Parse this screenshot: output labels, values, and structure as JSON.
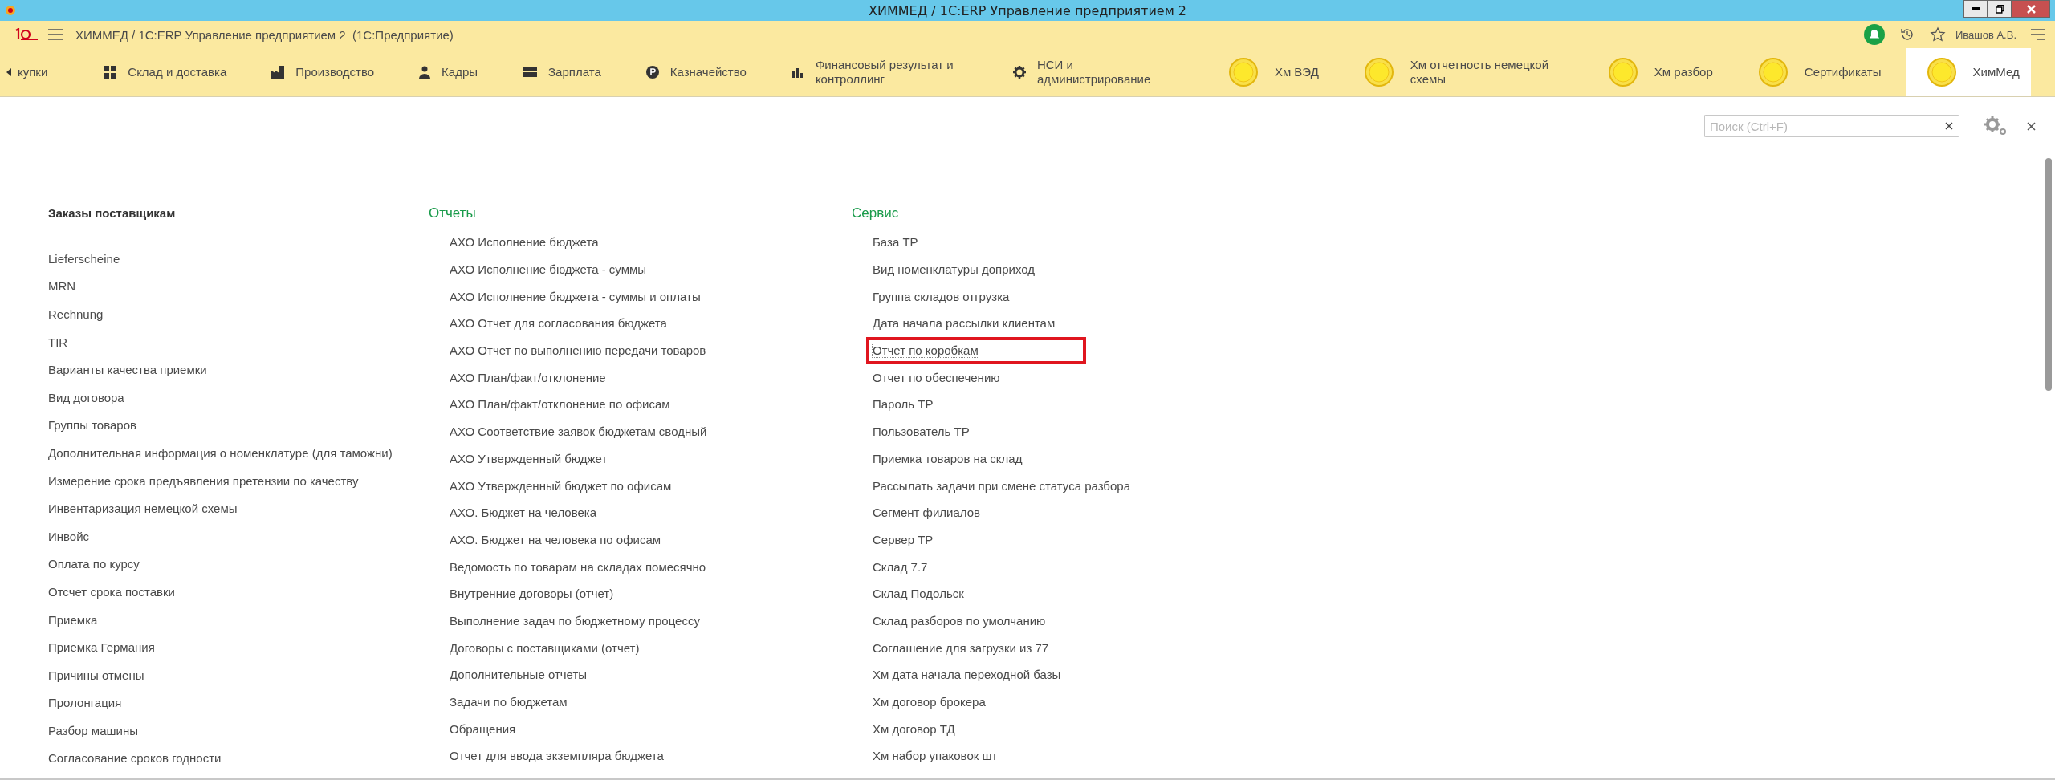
{
  "window": {
    "title": "ХИММЕД / 1С:ERP Управление предприятием 2"
  },
  "app_bar": {
    "title": "ХИММЕД / 1С:ERP Управление предприятием 2  (1С:Предприятие)",
    "user": "Ивашов А.В."
  },
  "sections": [
    {
      "label": "купки",
      "kind": "plain",
      "selected": false
    },
    {
      "label": "Склад и доставка",
      "kind": "grid",
      "selected": false
    },
    {
      "label": "Производство",
      "kind": "factory",
      "selected": false
    },
    {
      "label": "Кадры",
      "kind": "person",
      "selected": false
    },
    {
      "label": "Зарплата",
      "kind": "cash",
      "selected": false
    },
    {
      "label": "Казначейство",
      "kind": "coin",
      "selected": false
    },
    {
      "label": "Финансовый результат и контроллинг",
      "kind": "chart",
      "selected": false
    },
    {
      "label": "НСИ и администрирование",
      "kind": "gear",
      "selected": false
    },
    {
      "label": "Хм ВЭД",
      "kind": "custom",
      "selected": false
    },
    {
      "label": "Хм отчетность немецкой схемы",
      "kind": "custom",
      "selected": false
    },
    {
      "label": "Хм разбор",
      "kind": "custom",
      "selected": false
    },
    {
      "label": "Сертификаты",
      "kind": "custom",
      "selected": false
    },
    {
      "label": "ХимМед",
      "kind": "custom",
      "selected": true
    }
  ],
  "search": {
    "placeholder": "Поиск (Ctrl+F)"
  },
  "columns": [
    {
      "title": "Заказы поставщикам",
      "kind": "group",
      "items": [
        {
          "label": "Lieferscheine",
          "highlighted": false
        },
        {
          "label": "MRN",
          "highlighted": false
        },
        {
          "label": "Rechnung",
          "highlighted": false
        },
        {
          "label": "TIR",
          "highlighted": false
        },
        {
          "label": "Варианты качества приемки",
          "highlighted": false
        },
        {
          "label": "Вид договора",
          "highlighted": false
        },
        {
          "label": "Группы товаров",
          "highlighted": false
        },
        {
          "label": "Дополнительная информация о номенклатуре (для таможни)",
          "highlighted": false
        },
        {
          "label": "Измерение срока предъявления претензии по качеству",
          "highlighted": false
        },
        {
          "label": "Инвентаризация немецкой схемы",
          "highlighted": false
        },
        {
          "label": "Инвойс",
          "highlighted": false
        },
        {
          "label": "Оплата по курсу",
          "highlighted": false
        },
        {
          "label": "Отсчет срока поставки",
          "highlighted": false
        },
        {
          "label": "Приемка",
          "highlighted": false
        },
        {
          "label": "Приемка Германия",
          "highlighted": false
        },
        {
          "label": "Причины отмены",
          "highlighted": false
        },
        {
          "label": "Пролонгация",
          "highlighted": false
        },
        {
          "label": "Разбор машины",
          "highlighted": false
        },
        {
          "label": "Согласование сроков годности",
          "highlighted": false
        }
      ]
    },
    {
      "title": "Отчеты",
      "kind": "section",
      "items": [
        {
          "label": "АХО Исполнение бюджета",
          "highlighted": false
        },
        {
          "label": "АХО Исполнение бюджета - суммы",
          "highlighted": false
        },
        {
          "label": "АХО Исполнение бюджета - суммы и оплаты",
          "highlighted": false
        },
        {
          "label": "АХО Отчет для согласования бюджета",
          "highlighted": false
        },
        {
          "label": "АХО Отчет по выполнению передачи товаров",
          "highlighted": false
        },
        {
          "label": "АХО План/факт/отклонение",
          "highlighted": false
        },
        {
          "label": "АХО План/факт/отклонение по офисам",
          "highlighted": false
        },
        {
          "label": "АХО Соответствие заявок бюджетам сводный",
          "highlighted": false
        },
        {
          "label": "АХО Утвержденный бюджет",
          "highlighted": false
        },
        {
          "label": "АХО Утвержденный бюджет по офисам",
          "highlighted": false
        },
        {
          "label": "АХО. Бюджет на человека",
          "highlighted": false
        },
        {
          "label": "АХО. Бюджет на человека по офисам",
          "highlighted": false
        },
        {
          "label": "Ведомость по товарам на складах помесячно",
          "highlighted": false
        },
        {
          "label": "Внутренние договоры (отчет)",
          "highlighted": false
        },
        {
          "label": "Выполнение задач по бюджетному процессу",
          "highlighted": false
        },
        {
          "label": "Договоры с поставщиками (отчет)",
          "highlighted": false
        },
        {
          "label": "Дополнительные отчеты",
          "highlighted": false
        },
        {
          "label": "Задачи по бюджетам",
          "highlighted": false
        },
        {
          "label": "Обращения",
          "highlighted": false
        },
        {
          "label": "Отчет для ввода экземпляра бюджета",
          "highlighted": false
        }
      ]
    },
    {
      "title": "Сервис",
      "kind": "section",
      "items": [
        {
          "label": "База ТР",
          "highlighted": false
        },
        {
          "label": "Вид номенклатуры доприход",
          "highlighted": false
        },
        {
          "label": "Группа складов отгрузка",
          "highlighted": false
        },
        {
          "label": "Дата начала рассылки клиентам",
          "highlighted": false
        },
        {
          "label": "Отчет по коробкам",
          "highlighted": true
        },
        {
          "label": "Отчет по обеспечению",
          "highlighted": false
        },
        {
          "label": "Пароль ТР",
          "highlighted": false
        },
        {
          "label": "Пользователь ТР",
          "highlighted": false
        },
        {
          "label": "Приемка товаров на склад",
          "highlighted": false
        },
        {
          "label": "Рассылать задачи при смене статуса разбора",
          "highlighted": false
        },
        {
          "label": "Сегмент филиалов",
          "highlighted": false
        },
        {
          "label": "Сервер ТР",
          "highlighted": false
        },
        {
          "label": "Склад 7.7",
          "highlighted": false
        },
        {
          "label": "Склад Подольск",
          "highlighted": false
        },
        {
          "label": "Склад разборов по умолчанию",
          "highlighted": false
        },
        {
          "label": "Соглашение для загрузки из 77",
          "highlighted": false
        },
        {
          "label": "Хм дата начала переходной базы",
          "highlighted": false
        },
        {
          "label": "Хм договор брокера",
          "highlighted": false
        },
        {
          "label": "Хм договор ТД",
          "highlighted": false
        },
        {
          "label": "Хм набор упаковок шт",
          "highlighted": false
        }
      ]
    }
  ]
}
